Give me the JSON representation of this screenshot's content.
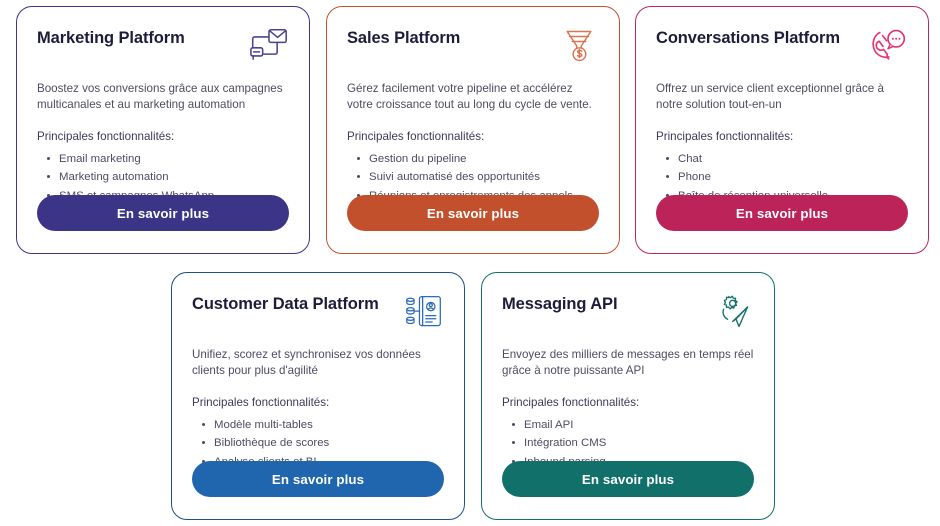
{
  "page": {
    "background": "#ffffff",
    "cta_label_default": "En savoir plus",
    "features_label": "Principales fonctionnalités:"
  },
  "cards": [
    {
      "id": "marketing",
      "title": "Marketing Platform",
      "description": "Boostez vos conversions grâce aux campagnes multicanales et au marketing automation",
      "features_label": "Principales fonctionnalités:",
      "features": [
        "Email marketing",
        "Marketing automation",
        "SMS et campagnes WhatsApp"
      ],
      "cta_label": "En savoir plus",
      "icon_name": "envelope-chat-icon",
      "border_color": "#3b3487",
      "button_color": "#3b3487",
      "icon_color": "#4a4392"
    },
    {
      "id": "sales",
      "title": "Sales Platform",
      "description": "Gérez facilement votre pipeline et accélérez votre croissance tout au long du cycle de vente.",
      "features_label": "Principales fonctionnalités:",
      "features": [
        "Gestion du pipeline",
        "Suivi automatisé des opportunités",
        "Réunions et enregistrements des appels"
      ],
      "cta_label": "En savoir plus",
      "icon_name": "sales-funnel-dollar-icon",
      "border_color": "#c25130",
      "button_color": "#c2502c",
      "icon_color": "#d9744f"
    },
    {
      "id": "conversations",
      "title": "Conversations Platform",
      "description": "Offrez un service client exceptionnel grâce à notre solution tout-en-un",
      "features_label": "Principales fonctionnalités:",
      "features": [
        "Chat",
        "Phone",
        "Boîte de réception universelle"
      ],
      "cta_label": "En savoir plus",
      "icon_name": "phone-chat-bubble-icon",
      "border_color": "#b9275c",
      "button_color": "#bc2359",
      "icon_color": "#e5326e"
    },
    {
      "id": "cdp",
      "title": "Customer Data Platform",
      "description": "Unifiez, scorez et synchronisez vos données clients pour plus d'agilité",
      "features_label": "Principales fonctionnalités:",
      "features": [
        "Modèle multi-tables",
        "Bibliothèque de scores",
        "Analyse clients et BI"
      ],
      "cta_label": "En savoir plus",
      "icon_name": "database-profile-card-icon",
      "border_color": "#1f4e8c",
      "button_color": "#1f66ae",
      "icon_color": "#2a6bb5"
    },
    {
      "id": "messaging",
      "title": "Messaging API",
      "description": "Envoyez des milliers de messages en temps réel grâce à notre puissante API",
      "features_label": "Principales fonctionnalités:",
      "features": [
        "Email API",
        "Intégration CMS",
        "Inbound parsing"
      ],
      "cta_label": "En savoir plus",
      "icon_name": "paper-plane-gear-icon",
      "border_color": "#14706b",
      "button_color": "#11706a",
      "icon_color": "#14706b"
    }
  ]
}
